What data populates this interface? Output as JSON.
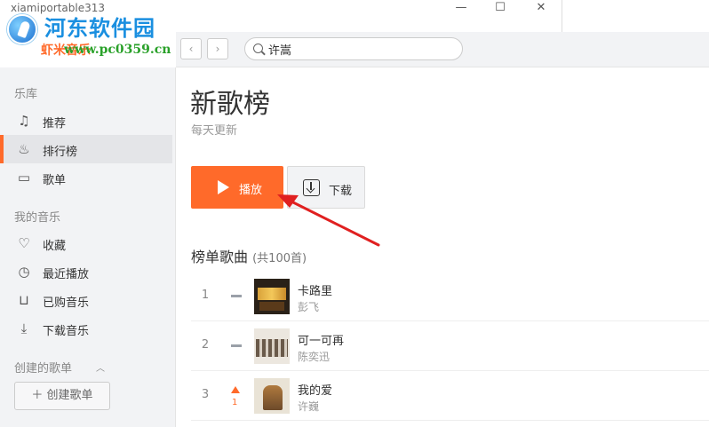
{
  "window": {
    "title": "xiamiportable313",
    "minimize_glyph": "—",
    "maximize_glyph": "☐",
    "close_glyph": "✕"
  },
  "watermark": {
    "title": "河东软件园",
    "url": "www.pc0359.cn"
  },
  "logo": {
    "app_name": "虾米音乐",
    "icon": "xiami-logo-icon"
  },
  "topnav": {
    "back_glyph": "‹",
    "forward_glyph": "›",
    "search": {
      "value": "许嵩",
      "placeholder": ""
    }
  },
  "sidebar": {
    "library_heading": "乐库",
    "library_items": [
      {
        "label": "推荐",
        "icon": "music-note-icon",
        "glyph": "♫"
      },
      {
        "label": "排行榜",
        "icon": "flame-icon",
        "glyph": "♨",
        "active": true
      },
      {
        "label": "歌单",
        "icon": "playlist-screen-icon",
        "glyph": "▭"
      }
    ],
    "my_music_heading": "我的音乐",
    "my_music_items": [
      {
        "label": "收藏",
        "icon": "heart-icon",
        "glyph": "♡"
      },
      {
        "label": "最近播放",
        "icon": "clock-icon",
        "glyph": "◷"
      },
      {
        "label": "已购音乐",
        "icon": "cart-icon",
        "glyph": "⊔"
      },
      {
        "label": "下载音乐",
        "icon": "download-icon",
        "glyph": "⤓"
      }
    ],
    "created_playlists_heading": "创建的歌单",
    "collapse_glyph": "︿",
    "create_playlist_label": "＋ 创建歌单"
  },
  "main": {
    "title": "新歌榜",
    "subtitle": "每天更新",
    "play_label": "播放",
    "download_label": "下载",
    "section_title": "榜单歌曲",
    "section_count": "(共100首)",
    "songs": [
      {
        "rank": "1",
        "trend": "same",
        "trend_change": "",
        "name": "卡路里",
        "artist": "彭飞"
      },
      {
        "rank": "2",
        "trend": "same",
        "trend_change": "",
        "name": "可一可再",
        "artist": "陈奕迅"
      },
      {
        "rank": "3",
        "trend": "up",
        "trend_change": "1",
        "name": "我的爱",
        "artist": "许巍"
      }
    ]
  },
  "colors": {
    "accent": "#ff6a2a",
    "sidebar_bg": "#f2f3f5",
    "annotation_arrow": "#e02020"
  }
}
